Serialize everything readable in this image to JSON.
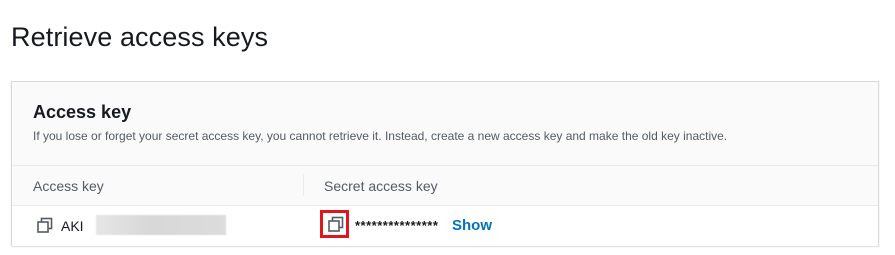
{
  "page": {
    "title": "Retrieve access keys"
  },
  "panel": {
    "title": "Access key",
    "description": "If you lose or forget your secret access key, you cannot retrieve it. Instead, create a new access key and make the old key inactive."
  },
  "table": {
    "columns": [
      "Access key",
      "Secret access key"
    ],
    "row": {
      "access_key_prefix": "AKI",
      "secret_masked": "***************",
      "show_label": "Show"
    }
  },
  "icons": {
    "copy": "copy-icon"
  },
  "colors": {
    "link": "#0073bb",
    "highlight": "#e0161b",
    "text": "#16191f",
    "muted": "#545b64"
  }
}
